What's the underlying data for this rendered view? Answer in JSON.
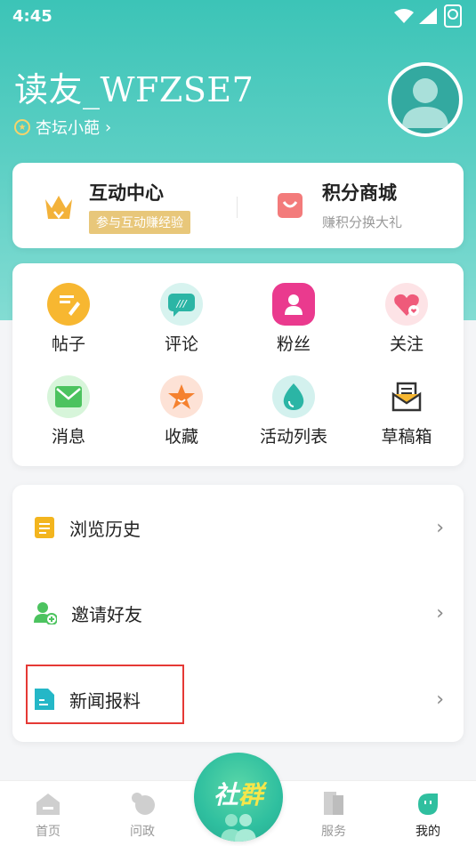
{
  "status_bar": {
    "time": "4:45"
  },
  "profile": {
    "username": "读友_WFZSE7",
    "level_label": "杏坛小葩"
  },
  "top_card": {
    "interaction": {
      "title": "互动中心",
      "badge": "参与互动赚经验"
    },
    "points_mall": {
      "title": "积分商城",
      "subtitle": "赚积分换大礼"
    }
  },
  "grid": [
    {
      "label": "帖子",
      "icon": "post-icon"
    },
    {
      "label": "评论",
      "icon": "comment-icon"
    },
    {
      "label": "粉丝",
      "icon": "fans-icon"
    },
    {
      "label": "关注",
      "icon": "follow-icon"
    },
    {
      "label": "消息",
      "icon": "message-icon"
    },
    {
      "label": "收藏",
      "icon": "favorite-icon"
    },
    {
      "label": "活动列表",
      "icon": "activity-icon"
    },
    {
      "label": "草稿箱",
      "icon": "drafts-icon"
    }
  ],
  "list": [
    {
      "label": "浏览历史",
      "icon": "history-icon"
    },
    {
      "label": "邀请好友",
      "icon": "invite-icon"
    },
    {
      "label": "新闻报料",
      "icon": "news-report-icon"
    }
  ],
  "tabbar": {
    "home": "首页",
    "politics": "问政",
    "center": {
      "text_a": "社",
      "text_b": "群"
    },
    "service": "服务",
    "mine": "我的"
  },
  "colors": {
    "accent": "#3cc4b7",
    "gold": "#e8c77a",
    "highlight": "#e53935"
  }
}
